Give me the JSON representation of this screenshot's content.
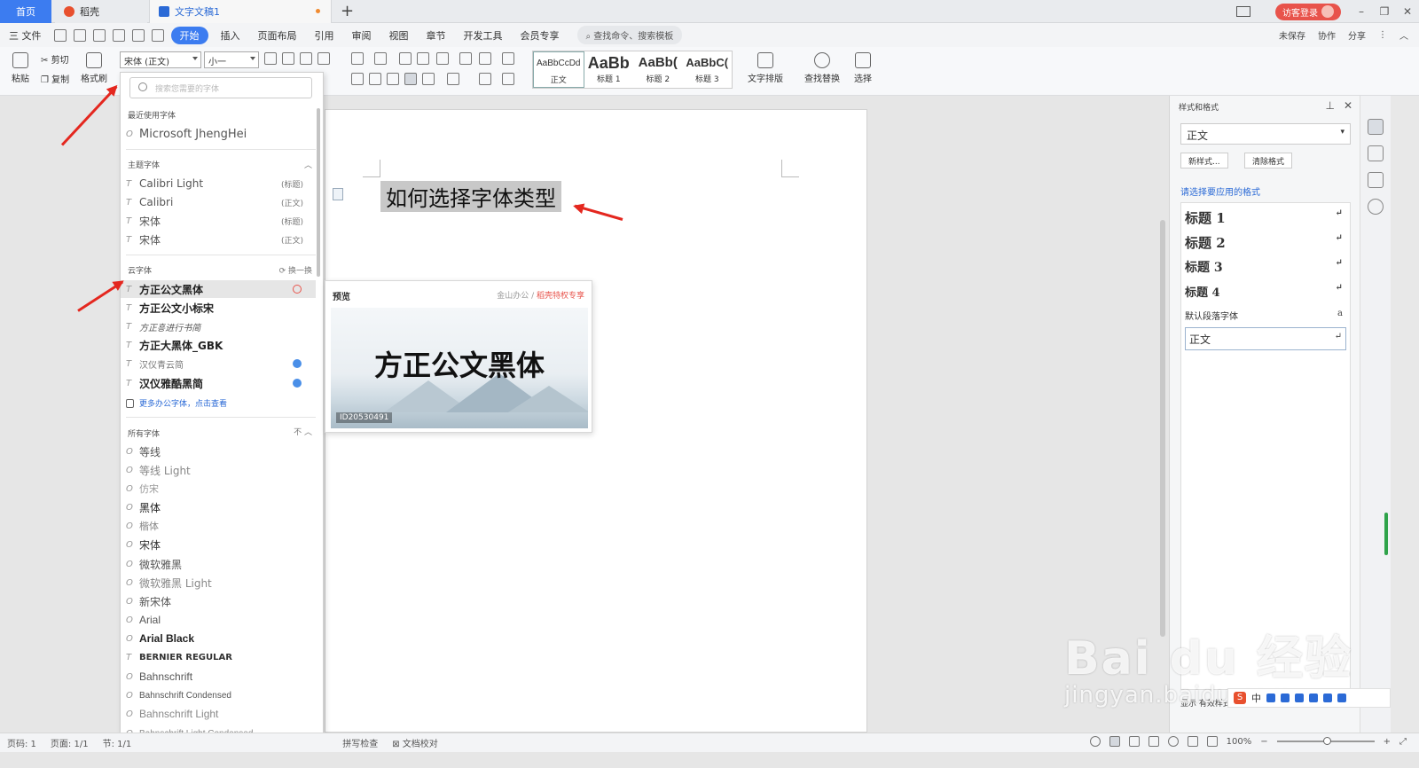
{
  "titlebar": {
    "tabs": [
      {
        "label": "首页"
      },
      {
        "label": "稻壳"
      },
      {
        "label": "文字文稿1"
      }
    ],
    "new_tab": "+",
    "login_label": "访客登录",
    "window_controls": [
      "–",
      "❐",
      "✕"
    ]
  },
  "menubar": {
    "file_label": "三 文件",
    "items": [
      "开始",
      "插入",
      "页面布局",
      "引用",
      "审阅",
      "视图",
      "章节",
      "开发工具",
      "会员专享"
    ],
    "search_placeholder": "查找命令、搜索模板",
    "right": [
      "未保存",
      "协作",
      "分享"
    ]
  },
  "ribbon": {
    "paste": "粘贴",
    "cut": "剪切",
    "copy": "复制",
    "format_painter": "格式刷",
    "font_value": "宋体 (正文)",
    "size_value": "小一",
    "styles": [
      {
        "preview": "AaBbCcDd",
        "label": "正文"
      },
      {
        "preview": "AaBb",
        "label": "标题 1"
      },
      {
        "preview": "AaBb(",
        "label": "标题 2"
      },
      {
        "preview": "AaBbC(",
        "label": "标题 3"
      }
    ],
    "text_layout": "文字排版",
    "find_replace": "查找替换",
    "select": "选择"
  },
  "font_dropdown": {
    "search_placeholder": "搜索您需要的字体",
    "recent_header": "最近使用字体",
    "recent": [
      {
        "name": "Microsoft JhengHei"
      }
    ],
    "theme_header": "主题字体",
    "theme": [
      {
        "name": "Calibri Light",
        "tag": "(标题)"
      },
      {
        "name": "Calibri",
        "tag": "(正文)"
      },
      {
        "name": "宋体",
        "tag": "(标题)"
      },
      {
        "name": "宋体",
        "tag": "(正文)"
      }
    ],
    "cloud_header": "云字体",
    "cloud_refresh": "换一换",
    "cloud": [
      {
        "name": "方正公文黑体"
      },
      {
        "name": "方正公文小标宋"
      },
      {
        "name": "方正흥进行书简"
      },
      {
        "name": "方正大黑体_GBK"
      },
      {
        "name": "汉仪青云简"
      },
      {
        "name": "汉仪雅酷黑简"
      }
    ],
    "more_link": "更多办公字体，点击查看",
    "all_header": "所有字体",
    "all": [
      {
        "name": "等线"
      },
      {
        "name": "等线 Light"
      },
      {
        "name": "仿宋"
      },
      {
        "name": "黑体"
      },
      {
        "name": "楷体"
      },
      {
        "name": "宋体"
      },
      {
        "name": "微软雅黑"
      },
      {
        "name": "微软雅黑 Light"
      },
      {
        "name": "新宋体"
      },
      {
        "name": "Arial"
      },
      {
        "name": "Arial Black"
      },
      {
        "name": "BERNIER REGULAR"
      },
      {
        "name": "Bahnschrift"
      },
      {
        "name": "Bahnschrift Condensed"
      },
      {
        "name": "Bahnschrift Light"
      },
      {
        "name": "Bahnschrift Light Condensed"
      }
    ]
  },
  "preview": {
    "header": "预览",
    "source": "金山办公 / ",
    "vip": "稻壳特权专享",
    "sample_text": "方正公文黑体",
    "id_text": "ID20530491"
  },
  "document": {
    "title_text": "如何选择字体类型"
  },
  "styles_panel": {
    "header": "样式和格式",
    "current_style": "正文",
    "new_style_btn": "新样式...",
    "clear_format_btn": "清除格式",
    "apply_link": "请选择要应用的格式",
    "items": [
      {
        "name": "标题 1"
      },
      {
        "name": "标题 2"
      },
      {
        "name": "标题 3"
      },
      {
        "name": "标题 4"
      },
      {
        "name": "默认段落字体"
      },
      {
        "name": "正文"
      }
    ],
    "bottom": "显示 有效样式"
  },
  "statusbar": {
    "page_num": "页码: 1",
    "pages": "页面: 1/1",
    "section": "节: 1/1",
    "spell": "拼写检查",
    "proofread": "文档校对",
    "zoom": "100%"
  },
  "watermark": {
    "main": "Bai du 经验",
    "sub": "jingyan.baidu.com"
  },
  "ime": {
    "label": "中"
  }
}
